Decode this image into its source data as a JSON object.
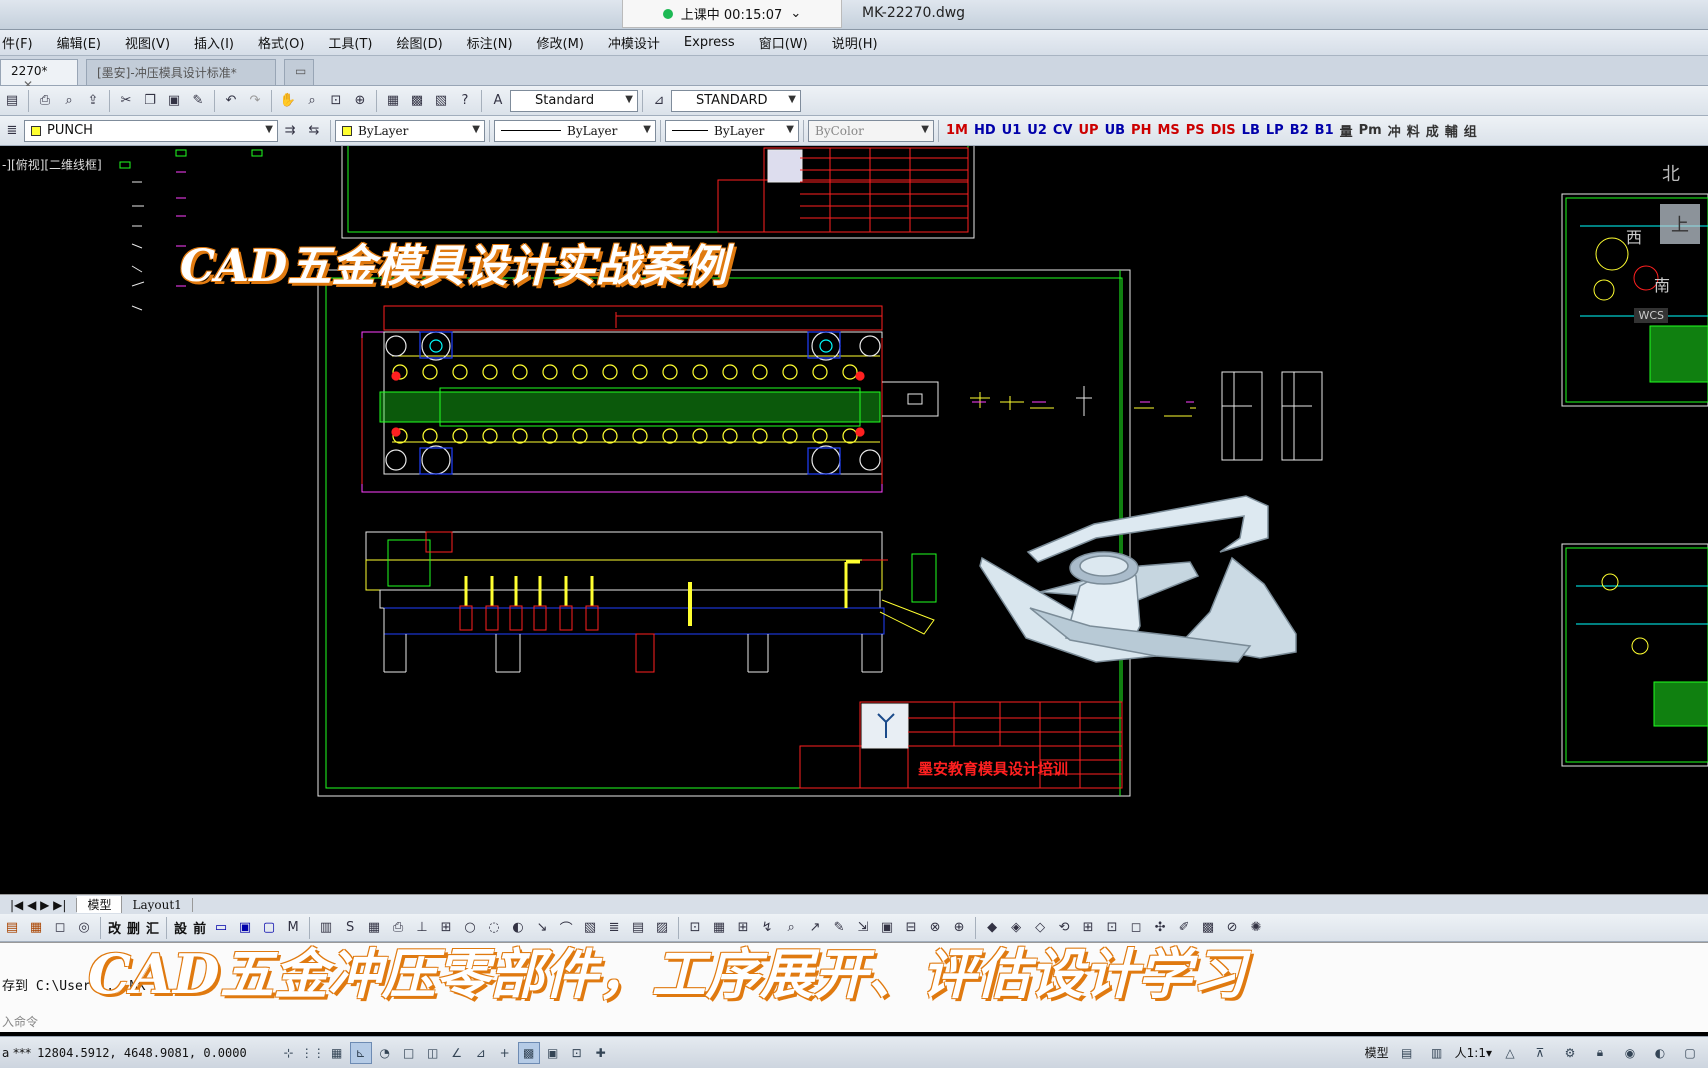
{
  "window": {
    "recording_status": "上课中 00:15:07",
    "doc_title": "MK-22270.dwg"
  },
  "menu": [
    "件(F)",
    "编辑(E)",
    "视图(V)",
    "插入(I)",
    "格式(O)",
    "工具(T)",
    "绘图(D)",
    "标注(N)",
    "修改(M)",
    "冲模设计",
    "Express",
    "窗口(W)",
    "说明(H)"
  ],
  "doc_tabs": [
    {
      "label": "2270*",
      "close": "✕"
    },
    {
      "label": "[墨安]-冲压模具设计标准*",
      "close": ""
    }
  ],
  "toolbar1": {
    "text_style": "Standard",
    "dim_style": "STANDARD"
  },
  "toolbar2": {
    "layer": "PUNCH",
    "color": "ByLayer",
    "linetype": "ByLayer",
    "lineweight": "ByLayer",
    "plot_style": "ByColor",
    "custom_buttons": [
      "1M",
      "HD",
      "U1",
      "U2",
      "CV",
      "UP",
      "UB",
      "PH",
      "MS",
      "PS",
      "DIS",
      "LB",
      "LP",
      "B2",
      "B1",
      "量",
      "Pm",
      "冲",
      "料",
      "成",
      "輔",
      "组"
    ]
  },
  "canvas": {
    "viewport_label": "-][俯视][二维线框]",
    "overlay_title": "CAD五金模具设计实战案例",
    "compass": {
      "north": "北",
      "up": "上",
      "west": "西",
      "south": "南",
      "wcs": "WCS"
    },
    "title_block_text": "墨安教育模具设计培训"
  },
  "layout_tabs": [
    "模型",
    "Layout1"
  ],
  "bottom_toolbar": [
    "改",
    "删",
    "汇",
    "設",
    "前"
  ],
  "command": {
    "history": "存到 C:\\User  ...  MK",
    "prompt": "入命令"
  },
  "overlay_subtitle": "CAD五金冲压零部件，工序展开、评估设计学习",
  "status": {
    "coords": "12804.5912, 4648.9081, 0.0000",
    "prefix": "a ***",
    "model": "模型",
    "scale": "人1:1▾"
  },
  "colors": {
    "cad_red": "#ff2020",
    "cad_green": "#20ff20",
    "cad_yellow": "#ffff30",
    "cad_magenta": "#ff40ff",
    "cad_white": "#e8e8e8",
    "overlay_orange": "#e07a10"
  }
}
